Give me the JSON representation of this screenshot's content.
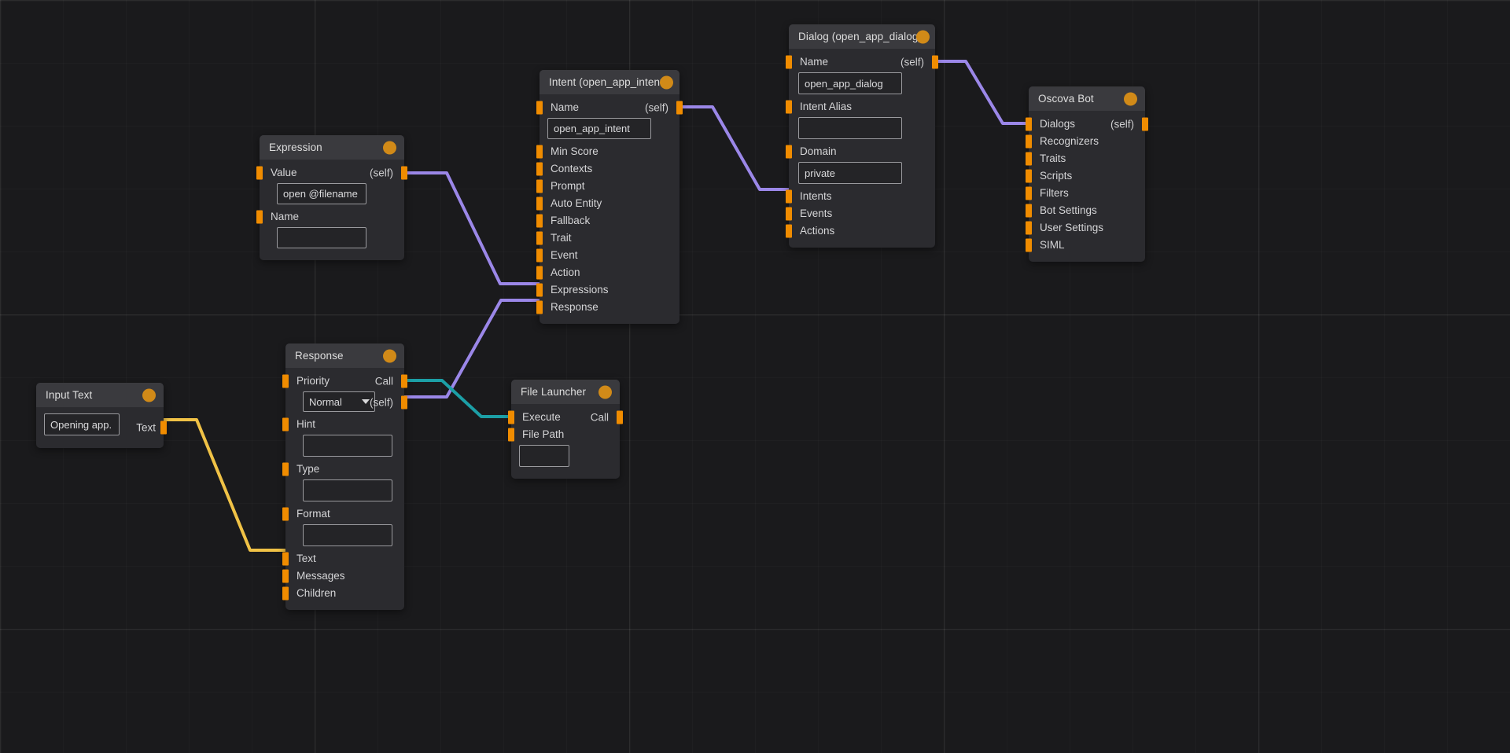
{
  "app": {
    "kind": "visual-node-graph-editor",
    "canvas_background": "#1a1a1c"
  },
  "colors": {
    "pin": "#f08c00",
    "node_body": "#2b2b2f",
    "node_header": "#3a3a3e",
    "wire_purple": "#9b87e8",
    "wire_teal": "#1c9fa6",
    "wire_yellow": "#f0c246",
    "text": "#d9d9db"
  },
  "labels": {
    "self": "(self)",
    "call": "Call",
    "text_out": "Text"
  },
  "nodes": {
    "input_text": {
      "title": "Input Text",
      "value": "Opening app.",
      "out_label": "Text"
    },
    "expression": {
      "title": "Expression",
      "rows": [
        {
          "label": "Value",
          "right": "(self)"
        },
        {
          "label": "Name",
          "right": ""
        }
      ],
      "value_field": "open @filename",
      "name_field": ""
    },
    "response": {
      "title": "Response",
      "priority_label": "Priority",
      "priority_value": "Normal",
      "call_label": "Call",
      "self_label": "(self)",
      "rows": [
        {
          "label": "Hint"
        },
        {
          "label": "Type"
        },
        {
          "label": "Format"
        },
        {
          "label": "Text"
        },
        {
          "label": "Messages"
        },
        {
          "label": "Children"
        }
      ],
      "hint_field": "",
      "type_field": "",
      "format_field": ""
    },
    "file_launcher": {
      "title": "File Launcher",
      "execute_label": "Execute",
      "call_label": "Call",
      "file_path_label": "File Path",
      "file_path_field": ""
    },
    "intent": {
      "title": "Intent (open_app_intent)",
      "name_label": "Name",
      "name_right": "(self)",
      "name_field": "open_app_intent",
      "rows": [
        {
          "label": "Min Score"
        },
        {
          "label": "Contexts"
        },
        {
          "label": "Prompt"
        },
        {
          "label": "Auto Entity"
        },
        {
          "label": "Fallback"
        },
        {
          "label": "Trait"
        },
        {
          "label": "Event"
        },
        {
          "label": "Action"
        },
        {
          "label": "Expressions"
        },
        {
          "label": "Response"
        }
      ]
    },
    "dialog": {
      "title": "Dialog (open_app_dialog)",
      "name_label": "Name",
      "name_right": "(self)",
      "name_field": "open_app_dialog",
      "intent_alias_label": "Intent Alias",
      "intent_alias_field": "",
      "domain_label": "Domain",
      "domain_field": "private",
      "rows": [
        {
          "label": "Intents"
        },
        {
          "label": "Events"
        },
        {
          "label": "Actions"
        }
      ]
    },
    "oscova_bot": {
      "title": "Oscova Bot",
      "rows": [
        {
          "label": "Dialogs",
          "right": "(self)"
        },
        {
          "label": "Recognizers",
          "right": ""
        },
        {
          "label": "Traits",
          "right": ""
        },
        {
          "label": "Scripts",
          "right": ""
        },
        {
          "label": "Filters",
          "right": ""
        },
        {
          "label": "Bot Settings",
          "right": ""
        },
        {
          "label": "User Settings",
          "right": ""
        },
        {
          "label": "SIML",
          "right": ""
        }
      ]
    }
  },
  "connections": [
    {
      "from": "input_text.Text",
      "to": "response.Text",
      "color": "#f0c246"
    },
    {
      "from": "expression.(self)",
      "to": "intent.Expressions",
      "color": "#9b87e8"
    },
    {
      "from": "response.(self)",
      "to": "intent.Response",
      "color": "#9b87e8"
    },
    {
      "from": "response.Call",
      "to": "file_launcher.Execute",
      "color": "#1c9fa6"
    },
    {
      "from": "intent.(self)",
      "to": "dialog.Intents",
      "color": "#9b87e8"
    },
    {
      "from": "dialog.(self)",
      "to": "oscova_bot.Dialogs",
      "color": "#9b87e8"
    }
  ]
}
